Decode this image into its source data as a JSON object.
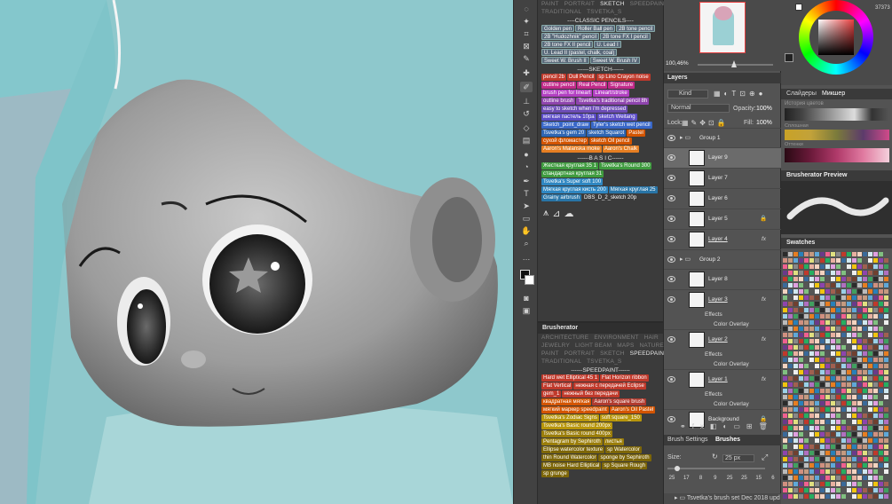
{
  "brushes_top": {
    "categories_row1": [
      "PAINT",
      "PORTRAIT",
      "SKETCH",
      "SPEEDPAINT"
    ],
    "categories_row2": [
      "TRADITIONAL",
      "TSVETKA_S"
    ],
    "active_category": "SKETCH",
    "classic_header": "----CLASSIC PENCILS----",
    "classic_items": [
      "Golden pen",
      "Roller Ball pen",
      "2B tone pencil",
      "2B \"Hudozhnik\" pencil",
      "2B tone FX I pencil",
      "2B tone FX II pencil",
      "U. Lead I",
      "U. Lead II (pastel, chalk, coal)",
      "Sweet W. Brush II",
      "Sweet W. Brush IV"
    ],
    "sketch_header": "------SKETCH------",
    "sketch_items": [
      {
        "t": "pencil 2b",
        "c": "#c0392b"
      },
      {
        "t": "Dull Pencil",
        "c": "#c0392b"
      },
      {
        "t": "sp Lino Crayon noise",
        "c": "#c0392b"
      },
      {
        "t": "outline pencil",
        "c": "#c22a8a"
      },
      {
        "t": "Real Pencil",
        "c": "#c22a8a"
      },
      {
        "t": "Signature",
        "c": "#c22a8a"
      },
      {
        "t": "brush pen for lineart",
        "c": "#b23fc2"
      },
      {
        "t": "Lineart/stroke",
        "c": "#b23fc2"
      },
      {
        "t": "outline brush",
        "c": "#8e44ad"
      },
      {
        "t": "Tsvetka's traditional pencil 8h",
        "c": "#8e44ad"
      },
      {
        "t": "easy to sketch when i'm depressed",
        "c": "#6c4cb6"
      },
      {
        "t": "мягкая пастель 10pa",
        "c": "#5b4cc6"
      },
      {
        "t": "sketch Weitang",
        "c": "#5b4cc6"
      },
      {
        "t": "Sketch_point_draw",
        "c": "#3867c8"
      },
      {
        "t": "Tyler's sketch wet pencil",
        "c": "#3867c8"
      },
      {
        "t": "Tsvetka's gem 20",
        "c": "#2f66b3"
      },
      {
        "t": "sketch Squarot",
        "c": "#2f66b3"
      },
      {
        "t": "Pastel",
        "c": "#d35400"
      },
      {
        "t": "сухой фломастер",
        "c": "#d35400"
      },
      {
        "t": "sketch Oil pencil",
        "c": "#d35400"
      },
      {
        "t": "Aaron's Malanska moke",
        "c": "#e67e22"
      },
      {
        "t": "Aaron's Chalk",
        "c": "#e67e22"
      }
    ],
    "basic_header": "------B A S I C------",
    "basic_items": [
      {
        "t": "Жесткая круглая 35 1",
        "c": "#3f9b3f"
      },
      {
        "t": "Tsvetka's Round 300",
        "c": "#3f9b3f"
      },
      {
        "t": "стандартная круглая 31",
        "c": "#3f9b3f"
      },
      {
        "t": "Tsvetka's Super soft 100",
        "c": "#2e86c1"
      },
      {
        "t": "Мягкая круглая кисть 200",
        "c": "#2e86c1"
      },
      {
        "t": "Мягкая круглая 25",
        "c": "#2874a6"
      },
      {
        "t": "Grainy airbrush",
        "c": "#2874a6"
      },
      {
        "t": "DBS_D_2_sketch 20p",
        "c": "#3b3b3b"
      }
    ]
  },
  "brusherator": {
    "title": "Brusherator",
    "categories_row1": [
      "ARCHITECTURE",
      "ENVIRONMENT",
      "HAIR"
    ],
    "categories_row2": [
      "JEWELRY",
      "LIGHT BEAM",
      "MAPS",
      "NATURE"
    ],
    "categories_row3": [
      "PAINT",
      "PORTRAIT",
      "SKETCH",
      "SPEEDPAINT"
    ],
    "categories_row4": [
      "TRADITIONAL",
      "TSVETKA_S"
    ],
    "active_category": "SPEEDPAINT",
    "speed_header": "------SPEEDPAINT------",
    "speed_items": [
      {
        "t": "Hard wet Elliptical 45 1",
        "c": "#c0392b"
      },
      {
        "t": "Flat Horizon ribbon",
        "c": "#c0392b"
      },
      {
        "t": "Flat Vertical",
        "c": "#c0392b"
      },
      {
        "t": "нежная с передачей Eclipse",
        "c": "#c0392b"
      },
      {
        "t": "gem_1",
        "c": "#c0392b"
      },
      {
        "t": "нежный без передачи",
        "c": "#c0392b"
      },
      {
        "t": "квадратная мягкая",
        "c": "#d35400"
      },
      {
        "t": "Aaron's square brush",
        "c": "#b03a2e"
      },
      {
        "t": "мягкий маркер speedpaint",
        "c": "#d35400"
      },
      {
        "t": "Aaron's Oil Pastel",
        "c": "#d35400"
      },
      {
        "t": "Tsvetka's Zodiac Signs",
        "c": "#b7950b"
      },
      {
        "t": "soft square_150",
        "c": "#b7950b"
      },
      {
        "t": "Tsvetka's Basic round 200px",
        "c": "#b7950b"
      },
      {
        "t": "Tsvetka's Basic round 400px",
        "c": "#9a7d0a"
      },
      {
        "t": "Pentagram by Sephiroth",
        "c": "#9a7d0a"
      },
      {
        "t": "листья",
        "c": "#9a7d0a"
      },
      {
        "t": "Ellipse watercolor texture",
        "c": "#7d6608"
      },
      {
        "t": "sp Watercolor",
        "c": "#7d6608"
      },
      {
        "t": "thin Round Watercolor",
        "c": "#7d6608"
      },
      {
        "t": "sponge by Sephiroth",
        "c": "#7d6608"
      },
      {
        "t": "MB noise Hard Elliptical",
        "c": "#7d6608"
      },
      {
        "t": "sp Square Rough",
        "c": "#7d6608"
      },
      {
        "t": "sp grunge",
        "c": "#7d6608"
      }
    ]
  },
  "navigator": {
    "zoom": "100,46%"
  },
  "layers": {
    "title": "Layers",
    "kind": "Kind",
    "blend": "Normal",
    "opacity_label": "Opacity:",
    "opacity": "100%",
    "lock_label": "Lock:",
    "fill_label": "Fill:",
    "fill": "100%",
    "rows": [
      {
        "name": "Group 1",
        "group": true
      },
      {
        "name": "Layer 9",
        "sel": true
      },
      {
        "name": "Layer 7"
      },
      {
        "name": "Layer 6"
      },
      {
        "name": "Layer 5",
        "lock": true
      },
      {
        "name": "Layer 4",
        "fx": true
      },
      {
        "name": "Group 2",
        "group": true
      },
      {
        "name": "Layer 8"
      },
      {
        "name": "Layer 3",
        "fx": true
      },
      {
        "name": "Layer 2",
        "fx": true
      },
      {
        "name": "Layer 1",
        "fx": true
      },
      {
        "name": "Background",
        "lock": true
      }
    ],
    "effects": "Effects",
    "color_overlay": "Color Overlay"
  },
  "brush_settings": {
    "tab1": "Brush Settings",
    "tab2": "Brushes",
    "size_label": "Size:",
    "size": "25 px",
    "presets": [
      "25",
      "17",
      "8",
      "9",
      "25",
      "25",
      "15",
      "6"
    ],
    "set_name": "Tsvetka's brush set Dec 2018 upd"
  },
  "right": {
    "color_value": "37373",
    "tab_sliders": "Слайдеры",
    "tab_mixer": "Микшер",
    "history_label": "История цветов",
    "brusherator_preview": "Brusherator Preview",
    "swatches": "Swatches",
    "sat_label": "Сплошная",
    "hue_label": "Оттенки",
    "value_label": "Светлота"
  },
  "colors": {
    "panel": "#535353",
    "dark": "#3b3b3b",
    "accent": "#2f75d6",
    "canvas_bg": "#9bd0d4"
  }
}
